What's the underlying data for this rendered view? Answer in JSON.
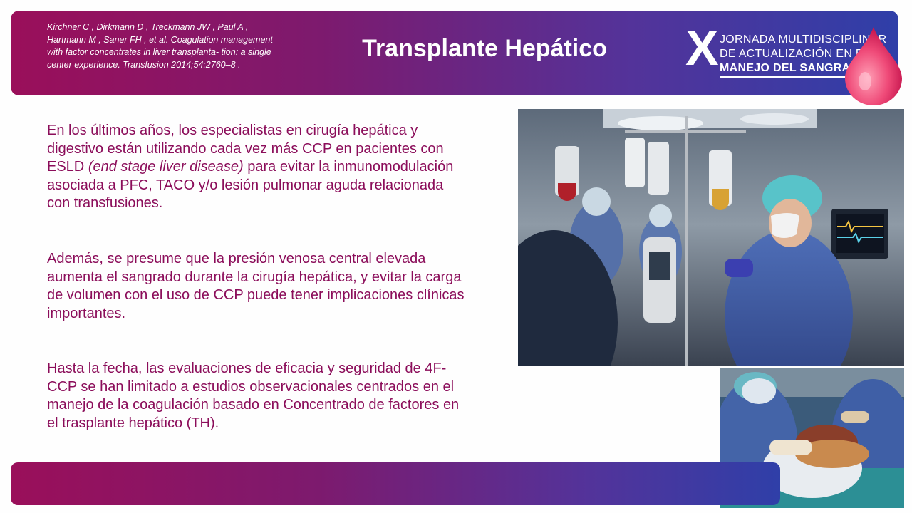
{
  "header": {
    "citation": "Kirchner C , Dirkmann D , Treckmann JW , Paul A , Hartmann M , Saner FH , et al. Coagulation management with factor concentrates in liver transplanta- tion: a single center experience. Transfusion 2014;54:2760–8 .",
    "title": "Transplante Hepático"
  },
  "logo": {
    "numeral": "X",
    "line1": "JORNADA MULTIDISCIPLINAR",
    "line2": "DE ACTUALIZACIÓN EN EL",
    "line3": "MANEJO DEL SANGRADO"
  },
  "body": {
    "p1_a": "En los últimos años, los especialistas en cirugía hepática y digestivo están utilizando cada vez más CCP en pacientes con ESLD ",
    "p1_em": "(end stage liver disease)",
    "p1_b": " para evitar la inmunomodulación asociada a PFC, TACO y/o lesión pulmonar aguda relacionada con transfusiones.",
    "p2": "Además, se presume que la presión venosa central elevada aumenta el sangrado durante la cirugía hepática, y evitar la carga de volumen con el uso de CCP puede tener implicaciones clínicas importantes.",
    "p3": "Hasta la fecha, las evaluaciones de eficacia y seguridad de 4F-CCP se han limitado a estudios observacionales centrados en el manejo de la coagulación basado en Concentrado de factores en el trasplante hepático (TH)."
  },
  "colors": {
    "header_gradient_start": "#9a0f5a",
    "header_gradient_end": "#2f3fa8",
    "body_text": "#8b0d5a",
    "drop": "#e8336b"
  },
  "icons": [
    "blood-drop-icon"
  ]
}
